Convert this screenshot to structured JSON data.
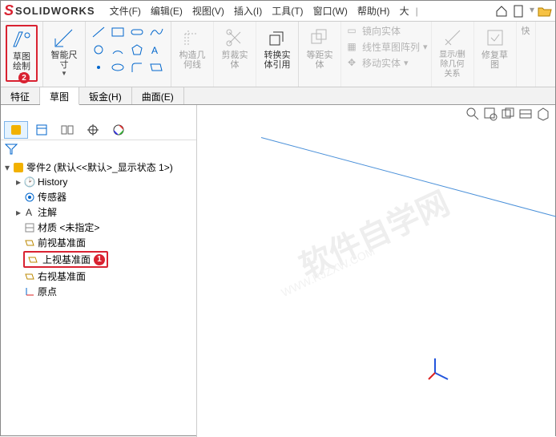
{
  "logo": "SOLIDWORKS",
  "menu": {
    "file": "文件(F)",
    "edit": "编辑(E)",
    "view": "视图(V)",
    "insert": "插入(I)",
    "tools": "工具(T)",
    "window": "窗口(W)",
    "help": "帮助(H)",
    "search": "大"
  },
  "ribbon": {
    "sketch": "草图绘制",
    "smartdim": "智能尺寸",
    "feat1": "构造几何线",
    "feat2": "剪裁实体",
    "feat3": "转换实体引用",
    "feat4": "等距实体",
    "mirror": "镜向实体",
    "pattern": "线性草图阵列",
    "move": "移动实体",
    "disp": "显示/删除几何关系",
    "repair": "修复草图",
    "quick": "快"
  },
  "tabs": {
    "feature": "特征",
    "sketch": "草图",
    "sheet": "钣金(H)",
    "surface": "曲面(E)"
  },
  "tree": {
    "root": "零件2 (默认<<默认>_显示状态 1>)",
    "history": "History",
    "sensor": "传感器",
    "annot": "注解",
    "material": "材质 <未指定>",
    "front": "前视基准面",
    "top": "上视基准面",
    "right": "右视基准面",
    "origin": "原点"
  },
  "wm": "软件自学网",
  "wmurl": "WWW.RJZXW.COM",
  "badges": {
    "b1": "1",
    "b2": "2"
  }
}
